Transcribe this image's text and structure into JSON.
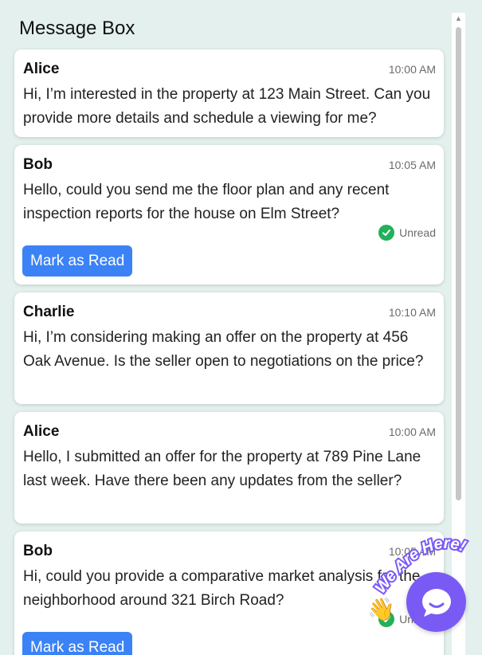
{
  "title": "Message Box",
  "messages": [
    {
      "sender": "Alice",
      "time": "10:00 AM",
      "body": "Hi, I’m interested in the property at 123 Main Street. Can you provide more details and schedule a viewing for me?"
    },
    {
      "sender": "Bob",
      "time": "10:05 AM",
      "body": "Hello, could you send me the floor plan and any recent inspection reports for the house on Elm Street?",
      "status": "Unread",
      "action": "Mark as Read"
    },
    {
      "sender": "Charlie",
      "time": "10:10 AM",
      "body": "Hi, I’m considering making an offer on the property at 456 Oak Avenue. Is the seller open to negotiations on the price?"
    },
    {
      "sender": "Alice",
      "time": "10:00 AM",
      "body": "Hello, I submitted an offer for the property at 789 Pine Lane last week. Have there been any updates from the seller?"
    },
    {
      "sender": "Bob",
      "time": "10:05 AM",
      "body": "Hi, could you provide a comparative market analysis for the neighborhood around 321 Birch Road?",
      "status": "Unread",
      "action": "Mark as Read"
    }
  ],
  "widget": {
    "badge_text": "We Are Here!",
    "icon": "chat-bubble-icon",
    "wave_icon": "waving-hand-icon"
  },
  "colors": {
    "background": "#e3f0ee",
    "button": "#3b82f6",
    "status_check": "#22b05a",
    "widget": "#7a5af5"
  }
}
